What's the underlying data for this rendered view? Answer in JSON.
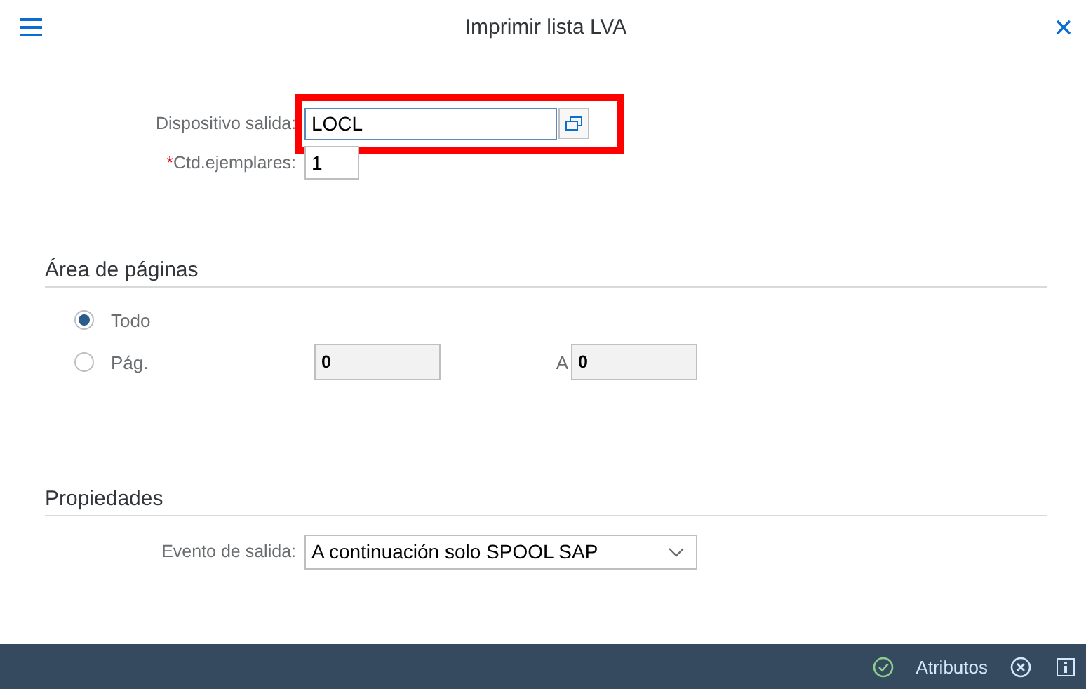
{
  "dialog": {
    "title": "Imprimir lista LVA"
  },
  "output_fields": [
    {
      "label": "Dispositivo salida:",
      "value": "LOCL",
      "highlighted": true,
      "has_value_help": true
    },
    {
      "label": "Ctd.ejemplares:",
      "value": "1",
      "required_mark": "*",
      "highlighted": false,
      "has_value_help": false
    }
  ],
  "page_area": {
    "title": "Área de páginas",
    "options": [
      {
        "label": "Todo",
        "selected": true
      },
      {
        "label": "Pág.",
        "selected": false
      }
    ],
    "from_value": "0",
    "to_label": "A",
    "to_value": "0"
  },
  "properties": {
    "title": "Propiedades",
    "event_label": "Evento de salida:",
    "event_value": "A continuación solo SPOOL SAP"
  },
  "footer": {
    "attributes_label": "Atributos"
  }
}
